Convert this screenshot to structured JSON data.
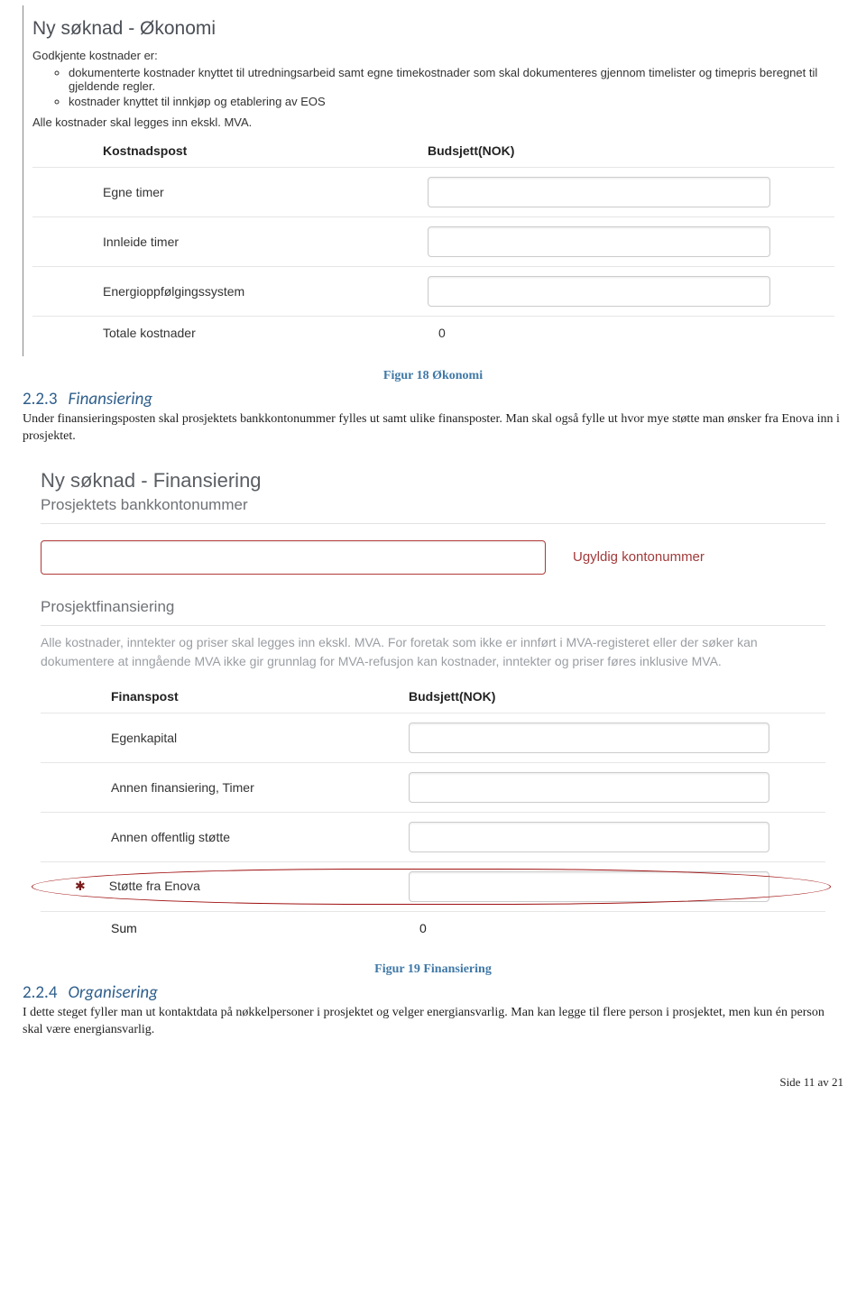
{
  "shot1": {
    "title": "Ny søknad - Økonomi",
    "intro": "Godkjente kostnader er:",
    "bullets": [
      "dokumenterte kostnader knyttet til utredningsarbeid samt egne timekostnader som skal dokumenteres gjennom timelister og timepris beregnet til gjeldende regler.",
      "kostnader knyttet til innkjøp og etablering av EOS"
    ],
    "mva_note": "Alle kostnader skal legges inn ekskl. MVA.",
    "head_label": "Kostnadspost",
    "head_value": "Budsjett(NOK)",
    "rows": [
      "Egne timer",
      "Innleide timer",
      "Energioppfølgingssystem"
    ],
    "total_label": "Totale kostnader",
    "total_value": "0"
  },
  "caption1": "Figur 18 Økonomi",
  "sec223": {
    "num": "2.2.3",
    "title": "Finansiering"
  },
  "p223": "Under finansieringsposten skal prosjektets bankkontonummer fylles ut samt ulike finansposter. Man skal også fylle ut hvor mye støtte man ønsker fra Enova inn i prosjektet.",
  "shot2": {
    "title": "Ny søknad - Finansiering",
    "sub1": "Prosjektets bankkontonummer",
    "konto_err": "Ugyldig kontonummer",
    "sub2": "Prosjektfinansiering",
    "help": "Alle kostnader, inntekter og priser skal legges inn ekskl. MVA. For foretak som ikke er innført i MVA-registeret eller der søker kan dokumentere at inngående MVA ikke gir grunnlag for MVA-refusjon kan kostnader, inntekter og priser føres inklusive MVA.",
    "head_label": "Finanspost",
    "head_value": "Budsjett(NOK)",
    "rows": [
      "Egenkapital",
      "Annen finansiering, Timer",
      "Annen offentlig støtte"
    ],
    "req_row": "Støtte fra Enova",
    "req_star": "✱",
    "sum_label": "Sum",
    "sum_value": "0"
  },
  "caption2": "Figur 19 Finansiering",
  "sec224": {
    "num": "2.2.4",
    "title": "Organisering"
  },
  "p224": "I dette steget fyller man ut kontaktdata på nøkkelpersoner i prosjektet og velger energiansvarlig. Man kan legge til flere person i prosjektet, men kun én person skal være energiansvarlig.",
  "footer": "Side 11 av 21"
}
